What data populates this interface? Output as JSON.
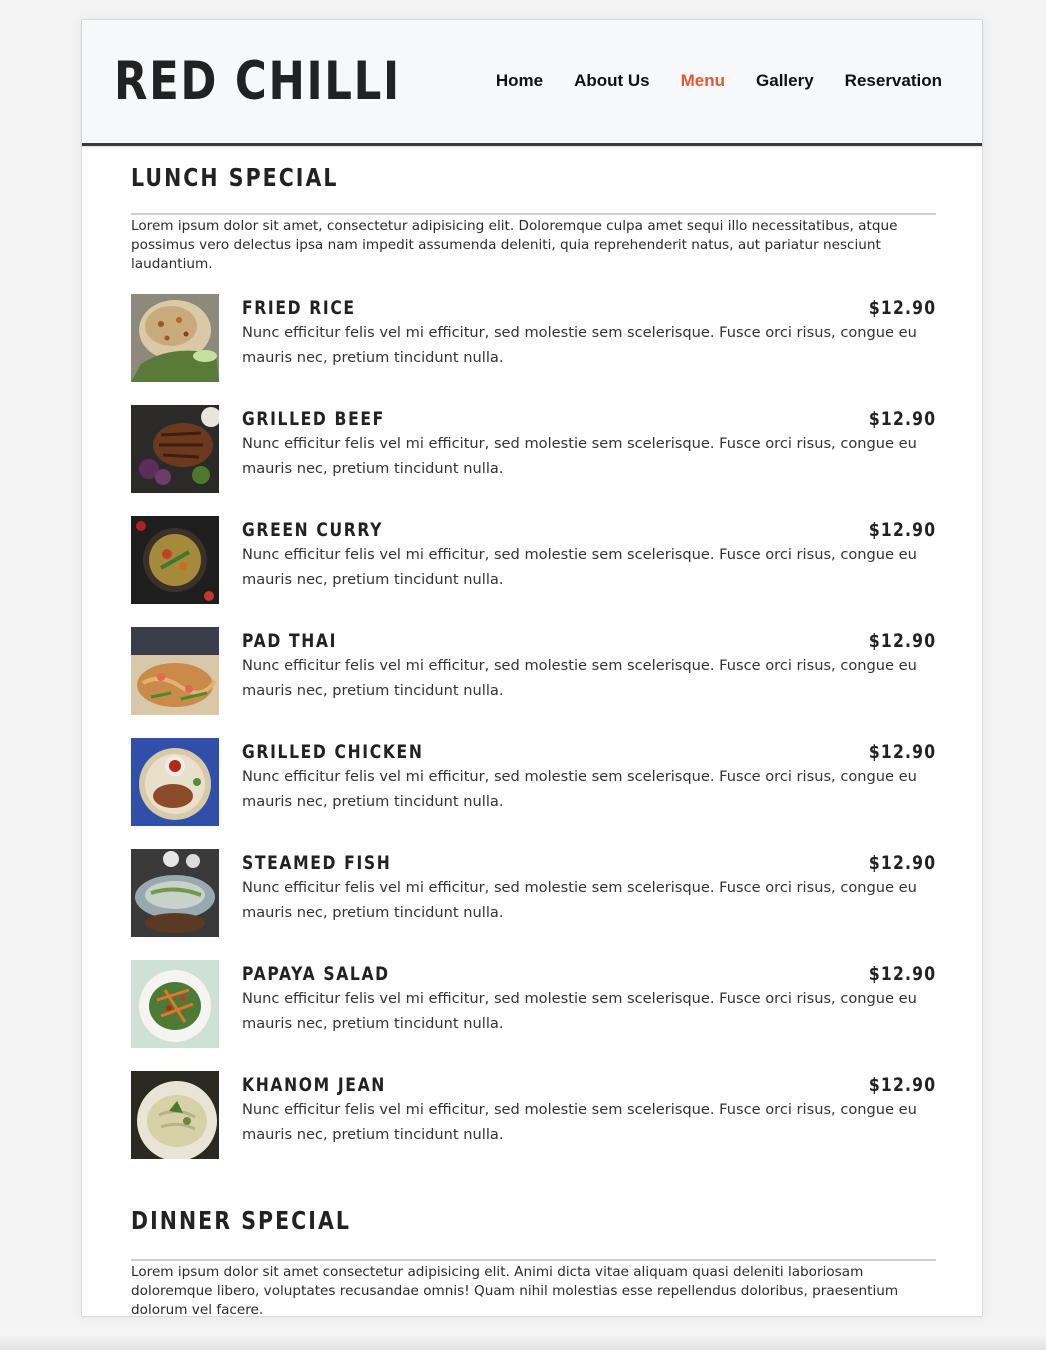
{
  "site": {
    "logo": "RED CHILLI"
  },
  "nav": {
    "items": [
      {
        "label": "Home",
        "active": false
      },
      {
        "label": "About Us",
        "active": false
      },
      {
        "label": "Menu",
        "active": true
      },
      {
        "label": "Gallery",
        "active": false
      },
      {
        "label": "Reservation",
        "active": false
      }
    ],
    "active_color": "#e0583a"
  },
  "lunch": {
    "title": "LUNCH SPECIAL",
    "description": "Lorem ipsum dolor sit amet, consectetur adipisicing elit. Doloremque culpa amet sequi illo necessitatibus, atque possimus vero delectus ipsa nam impedit assumenda deleniti, quia reprehenderit natus, aut pariatur nesciunt laudantium.",
    "items": [
      {
        "name": "FRIED RICE",
        "price": "$12.90",
        "description": "Nunc efficitur felis vel mi efficitur, sed molestie sem scelerisque. Fusce orci risus, congue eu mauris nec, pretium tincidunt nulla.",
        "image": "fried-rice-photo"
      },
      {
        "name": "GRILLED BEEF",
        "price": "$12.90",
        "description": "Nunc efficitur felis vel mi efficitur, sed molestie sem scelerisque. Fusce orci risus, congue eu mauris nec, pretium tincidunt nulla.",
        "image": "grilled-beef-photo"
      },
      {
        "name": "GREEN CURRY",
        "price": "$12.90",
        "description": "Nunc efficitur felis vel mi efficitur, sed molestie sem scelerisque. Fusce orci risus, congue eu mauris nec, pretium tincidunt nulla.",
        "image": "green-curry-photo"
      },
      {
        "name": "PAD THAI",
        "price": "$12.90",
        "description": "Nunc efficitur felis vel mi efficitur, sed molestie sem scelerisque. Fusce orci risus, congue eu mauris nec, pretium tincidunt nulla.",
        "image": "pad-thai-photo"
      },
      {
        "name": "GRILLED CHICKEN",
        "price": "$12.90",
        "description": "Nunc efficitur felis vel mi efficitur, sed molestie sem scelerisque. Fusce orci risus, congue eu mauris nec, pretium tincidunt nulla.",
        "image": "grilled-chicken-photo"
      },
      {
        "name": "STEAMED FISH",
        "price": "$12.90",
        "description": "Nunc efficitur felis vel mi efficitur, sed molestie sem scelerisque. Fusce orci risus, congue eu mauris nec, pretium tincidunt nulla.",
        "image": "steamed-fish-photo"
      },
      {
        "name": "PAPAYA SALAD",
        "price": "$12.90",
        "description": "Nunc efficitur felis vel mi efficitur, sed molestie sem scelerisque. Fusce orci risus, congue eu mauris nec, pretium tincidunt nulla.",
        "image": "papaya-salad-photo"
      },
      {
        "name": "KHANOM JEAN",
        "price": "$12.90",
        "description": "Nunc efficitur felis vel mi efficitur, sed molestie sem scelerisque. Fusce orci risus, congue eu mauris nec, pretium tincidunt nulla.",
        "image": "khanom-jean-photo"
      }
    ]
  },
  "dinner": {
    "title": "DINNER SPECIAL",
    "description": "Lorem ipsum dolor sit amet consectetur adipisicing elit. Animi dicta vitae aliquam quasi deleniti laboriosam doloremque libero, voluptates recusandae omnis! Quam nihil molestias esse repellendus doloribus, praesentium dolorum vel facere."
  }
}
